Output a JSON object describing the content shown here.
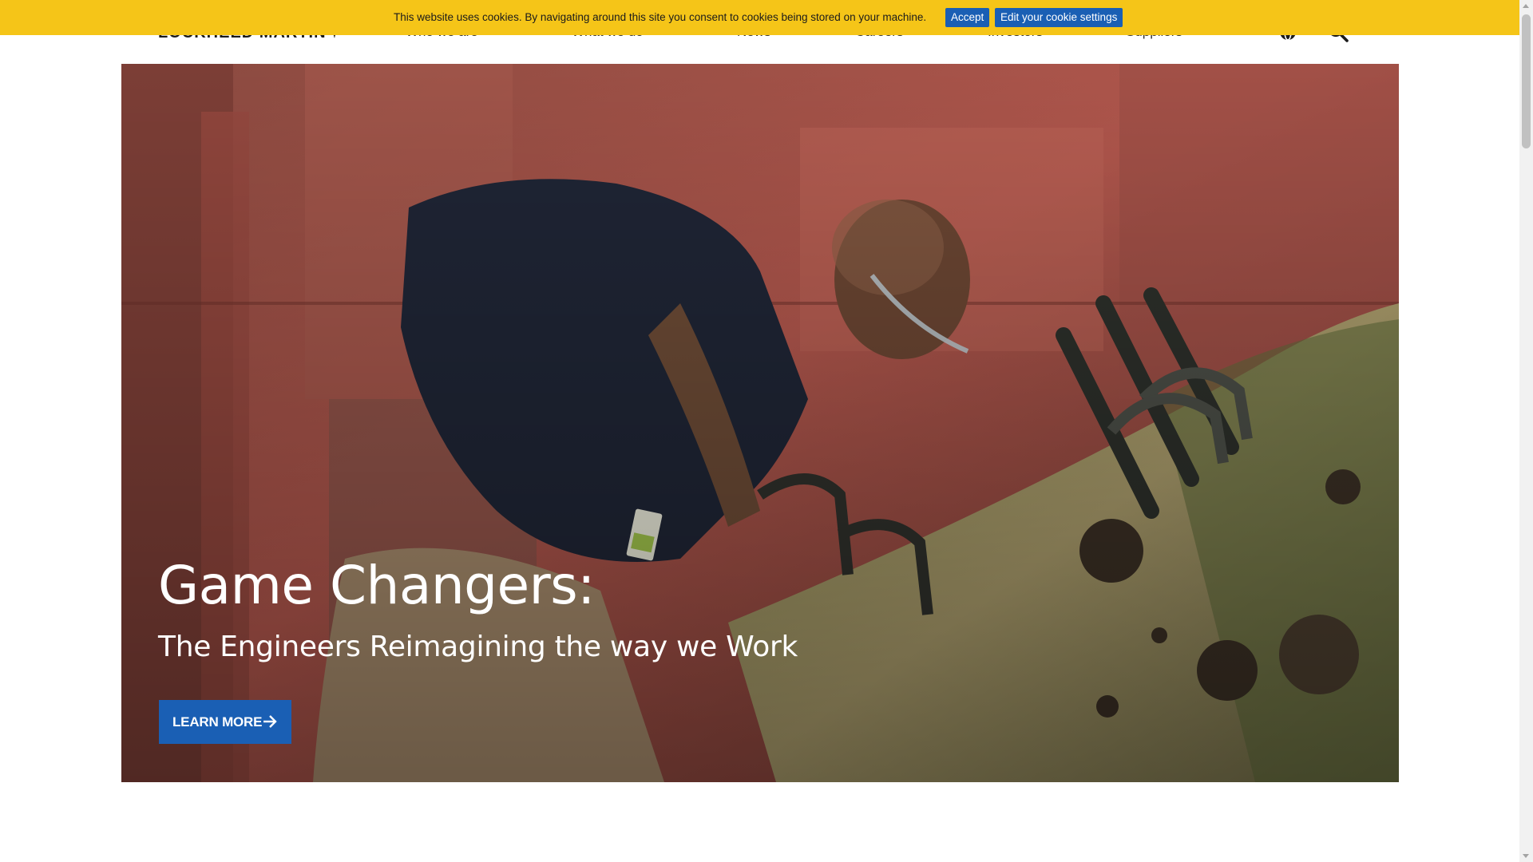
{
  "cookie_bar": {
    "message": "This website uses cookies. By navigating around this site you consent to cookies being stored on your machine.",
    "accept_label": "Accept",
    "settings_label": "Edit your cookie settings",
    "background": "#f5c518",
    "button_color": "#1a5fb4"
  },
  "header": {
    "logo_text": "LOCKHEED MARTIN",
    "nav": [
      {
        "label": "Who we are",
        "has_dropdown": true
      },
      {
        "label": "What we do",
        "has_dropdown": true
      },
      {
        "label": "News",
        "has_dropdown": false
      },
      {
        "label": "Careers",
        "has_dropdown": false
      },
      {
        "label": "Investors",
        "has_dropdown": false
      },
      {
        "label": "Suppliers",
        "has_dropdown": false
      }
    ],
    "icons": {
      "globe": "globe-icon",
      "search": "search-icon"
    }
  },
  "hero": {
    "title": "Game Changers:",
    "subtitle": "The Engineers Reimagining the way we Work",
    "cta_label": "LEARN MORE",
    "cta_icon": "arrow-right-icon",
    "accent": "#1a5fb4"
  }
}
